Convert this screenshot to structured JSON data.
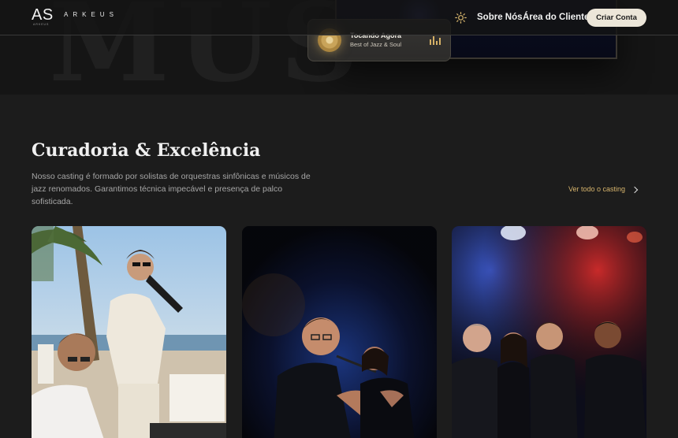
{
  "nav": {
    "logo_mark": "AS",
    "logo_word": "ARKEUS",
    "logo_tag": "ARKEUS",
    "links": [
      {
        "label": "Sobre Nós"
      },
      {
        "label": "Área do Cliente"
      }
    ],
    "cta_label": "Criar Conta",
    "theme_icon": "sun-icon"
  },
  "hero": {
    "bg_word": "MUS",
    "now_playing": {
      "title": "Tocando Agora",
      "subtitle": "Best of Jazz & Soul",
      "icon": "equalizer-icon"
    }
  },
  "section": {
    "title": "Curadoria & Excelência",
    "description": "Nosso casting é formado por solistas de orquestras sinfônicas e músicos de jazz renomados. Garantimos técnica impecável e presença de palco sofisticada.",
    "see_all_label": "Ver todo o casting",
    "see_all_icon": "chevron-right-icon"
  },
  "cards": [
    {
      "image": "beach-duo-photo",
      "alt_hint": "pianist and melodica player at a beach event"
    },
    {
      "image": "stage-duo-photo",
      "alt_hint": "singer duo on dark blue stage"
    },
    {
      "image": "band-photo",
      "alt_hint": "band posing under red and blue stage lights"
    }
  ],
  "colors": {
    "accent_gold": "#d6b46c",
    "background": "#1c1c1c",
    "button_bg": "#ece6d9"
  }
}
